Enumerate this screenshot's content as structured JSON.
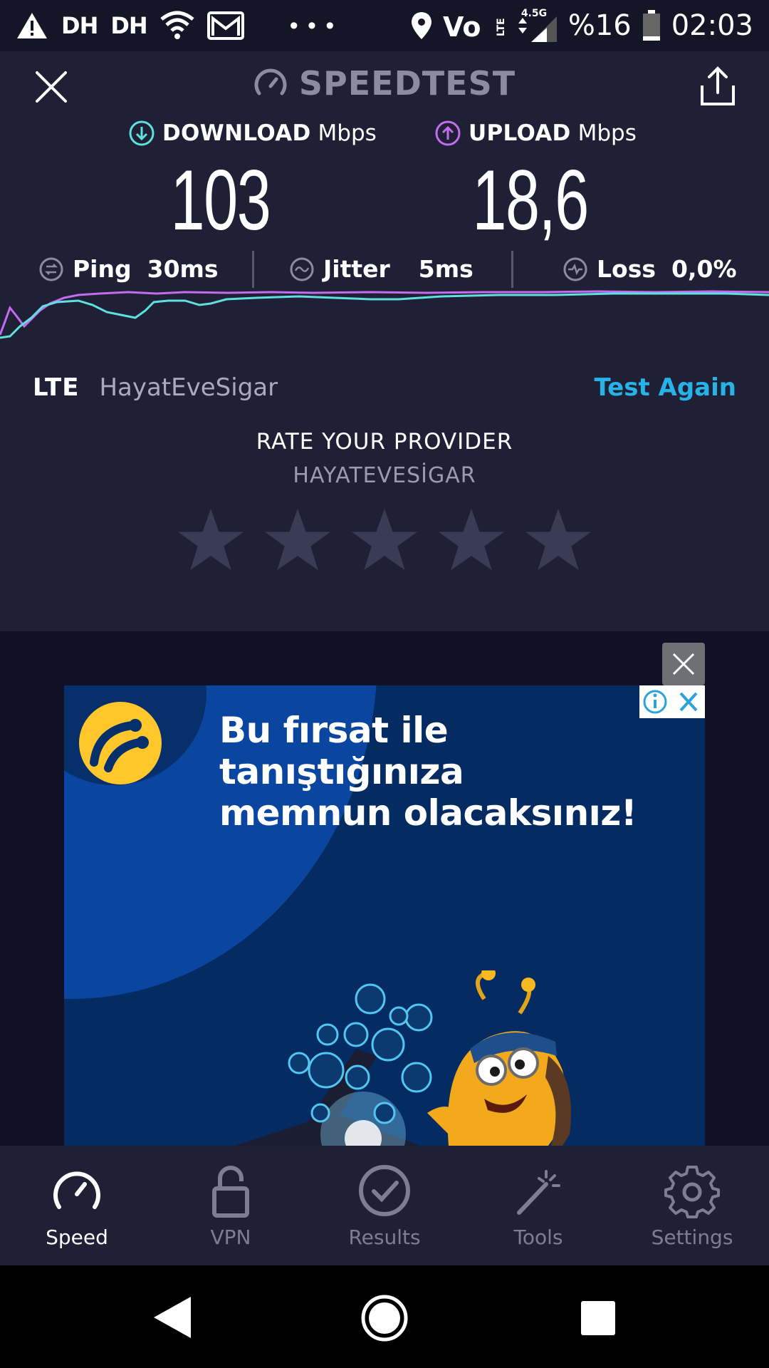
{
  "status_bar": {
    "carrier_1": "DH",
    "carrier_2": "DH",
    "network_badge": "4.5G",
    "battery": "%16",
    "time": "02:03"
  },
  "app": {
    "title": "SPEEDTEST",
    "download": {
      "label": "DOWNLOAD",
      "unit": "Mbps",
      "value": "103"
    },
    "upload": {
      "label": "UPLOAD",
      "unit": "Mbps",
      "value": "18,6"
    },
    "ping": {
      "label": "Ping",
      "value": "30ms"
    },
    "jitter": {
      "label": "Jitter",
      "value": "5ms"
    },
    "loss": {
      "label": "Loss",
      "value": "0,0%"
    },
    "network_type": "LTE",
    "network_name": "HayatEveSigar",
    "test_again": "Test Again",
    "rate_title": "RATE YOUR PROVIDER",
    "rate_provider": "HAYATEVESİGAR",
    "rating": 0
  },
  "ad": {
    "headline_line1": "Bu fırsat ile tanıştığınıza",
    "headline_line2": "memnun olacaksınız!"
  },
  "nav": {
    "items": [
      {
        "label": "Speed",
        "icon": "speedometer-icon"
      },
      {
        "label": "VPN",
        "icon": "lock-icon"
      },
      {
        "label": "Results",
        "icon": "check-circle-icon"
      },
      {
        "label": "Tools",
        "icon": "magic-wand-icon"
      },
      {
        "label": "Settings",
        "icon": "gear-icon"
      }
    ],
    "active": "Speed"
  },
  "colors": {
    "background": "#1f2036",
    "download_accent": "#5fe0de",
    "upload_accent": "#c46cf0",
    "link": "#27b3e8",
    "ad_blue": "#042c63"
  }
}
